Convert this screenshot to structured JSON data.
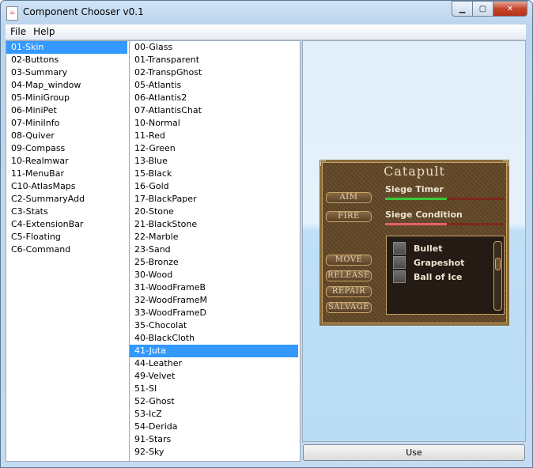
{
  "window": {
    "title": "Component Chooser v0.1"
  },
  "menubar": {
    "file": "File",
    "help": "Help"
  },
  "categories": {
    "selected": "01-Skin",
    "items": [
      "01-Skin",
      "02-Buttons",
      "03-Summary",
      "04-Map_window",
      "05-MiniGroup",
      "06-MiniPet",
      "07-MiniInfo",
      "08-Quiver",
      "09-Compass",
      "10-Realmwar",
      "11-MenuBar",
      "C10-AtlasMaps",
      "C2-SummaryAdd",
      "C3-Stats",
      "C4-ExtensionBar",
      "C5-Floating",
      "C6-Command"
    ]
  },
  "skins": {
    "selected": "41-Juta",
    "items": [
      "00-Glass",
      "01-Transparent",
      "02-TranspGhost",
      "05-Atlantis",
      "06-Atlantis2",
      "07-AtlantisChat",
      "10-Normal",
      "11-Red",
      "12-Green",
      "13-Blue",
      "15-Black",
      "16-Gold",
      "17-BlackPaper",
      "20-Stone",
      "21-BlackStone",
      "22-Marble",
      "23-Sand",
      "25-Bronze",
      "30-Wood",
      "31-WoodFrameB",
      "32-WoodFrameM",
      "33-WoodFrameD",
      "35-Chocolat",
      "40-BlackCloth",
      "41-Juta",
      "44-Leather",
      "49-Velvet",
      "51-SI",
      "52-Ghost",
      "53-IcZ",
      "54-Derida",
      "91-Stars",
      "92-Sky"
    ]
  },
  "preview": {
    "title": "Catapult",
    "buttons": [
      "AIM",
      "FIRE",
      "MOVE",
      "RELEASE",
      "REPAIR",
      "SALVAGE"
    ],
    "siege_timer": "Siege Timer",
    "siege_condition": "Siege Condition",
    "ammo": [
      "Bullet",
      "Grapeshot",
      "Ball of Ice"
    ],
    "colors": {
      "timer_bar": "#39c83a",
      "condition_bar": "#e8606a"
    }
  },
  "use_button": "Use"
}
